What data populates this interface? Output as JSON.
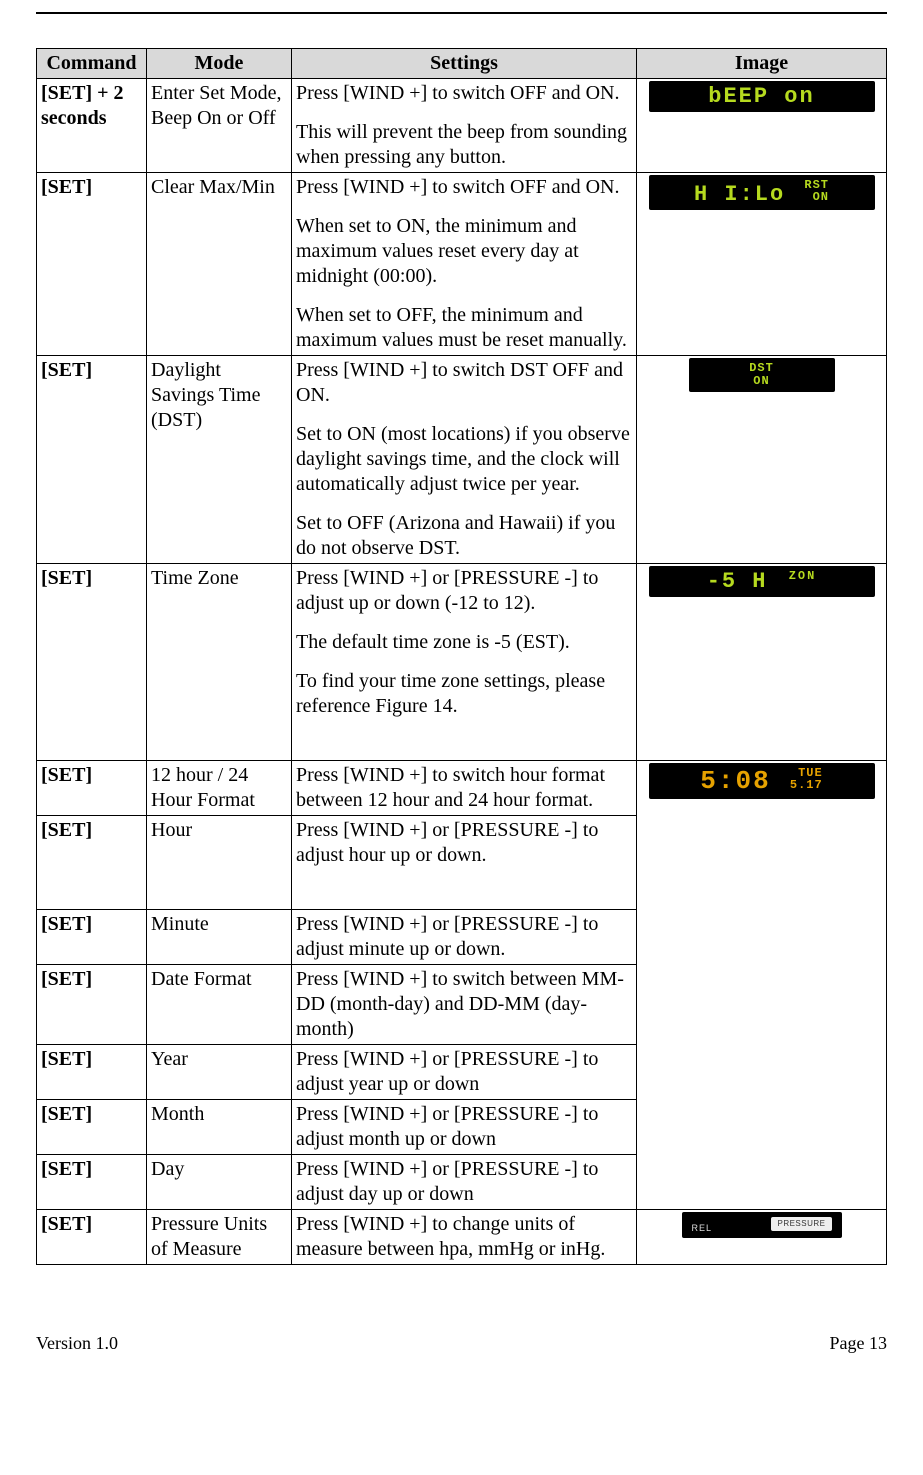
{
  "headers": {
    "command": "Command",
    "mode": "Mode",
    "settings": "Settings",
    "image": "Image"
  },
  "rows": [
    {
      "command": "[SET] + 2 seconds",
      "mode": "Enter Set Mode, Beep On or Off",
      "settings": [
        "Press [WIND +] to switch OFF and ON.",
        "This will prevent the beep from sounding when pressing any button."
      ],
      "image": {
        "type": "lcd-wide",
        "text": "bEEP   on"
      }
    },
    {
      "command": "[SET]",
      "mode": "Clear Max/Min",
      "settings": [
        "Press [WIND +] to switch OFF and ON.",
        "When set to ON, the minimum and maximum values reset every day at midnight (00:00).",
        "When set to OFF, the minimum and maximum values must be reset manually."
      ],
      "image": {
        "type": "lcd-hilo",
        "main": "H I:Lo",
        "topright": "RST",
        "botright": "ON"
      }
    },
    {
      "command": "[SET]",
      "mode": "Daylight Savings Time (DST)",
      "settings": [
        "Press [WIND +] to switch DST OFF and ON.",
        "Set to ON (most locations) if you observe daylight savings time, and the clock will automatically adjust twice per year.",
        "Set to OFF (Arizona and Hawaii) if you do not observe DST."
      ],
      "image": {
        "type": "lcd-stack",
        "top": "DST",
        "bot": "ON"
      }
    },
    {
      "command": "[SET]",
      "mode": "Time Zone",
      "settings": [
        "Press [WIND +] or [PRESSURE -] to adjust up or down (-12 to 12).",
        "The default time zone is -5 (EST).",
        "To find your time zone settings, please reference Figure 14."
      ],
      "image": {
        "type": "lcd-tz",
        "main": "-5 H",
        "label": "ZON"
      }
    },
    {
      "command": "[SET]",
      "mode": "12 hour / 24 Hour Format",
      "settings": [
        "Press [WIND +] to switch hour format between 12 hour and 24 hour format."
      ],
      "image": {
        "type": "lcd-time",
        "time": "5:08",
        "day": "TUE",
        "date": "5.17"
      }
    },
    {
      "command": "[SET]",
      "mode": "Hour",
      "settings": [
        "Press [WIND +] or [PRESSURE -] to adjust hour up or down."
      ]
    },
    {
      "command": "[SET]",
      "mode": "Minute",
      "settings": [
        "Press [WIND +] or [PRESSURE -] to adjust minute up or down."
      ]
    },
    {
      "command": "[SET]",
      "mode": "Date Format",
      "settings": [
        "Press [WIND +] to switch between MM-DD (month-day) and DD-MM (day-month)"
      ]
    },
    {
      "command": "[SET]",
      "mode": "Year",
      "settings": [
        "Press [WIND +] or [PRESSURE -] to adjust year up or down"
      ]
    },
    {
      "command": "[SET]",
      "mode": "Month",
      "settings": [
        "Press [WIND +] or [PRESSURE -] to adjust month up or down"
      ]
    },
    {
      "command": "[SET]",
      "mode": "Day",
      "settings": [
        "Press [WIND +] or [PRESSURE -] to adjust day up or down"
      ]
    },
    {
      "command": "[SET]",
      "mode": "Pressure Units of Measure",
      "settings": [
        "Press [WIND +] to change units of measure between hpa, mmHg or inHg."
      ],
      "image": {
        "type": "pressure",
        "rel": "REL",
        "btn": "PRESSURE"
      }
    }
  ],
  "footer": {
    "version": "Version 1.0",
    "page": "Page 13"
  }
}
